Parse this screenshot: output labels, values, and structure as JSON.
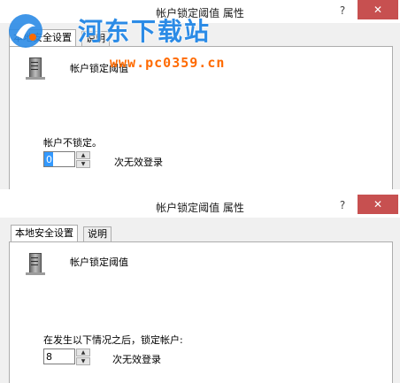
{
  "top_dialog": {
    "title": "帐户锁定阈值 属性",
    "help": "?",
    "close": "✕",
    "tabs": [
      {
        "label": "本地安全设置"
      },
      {
        "label": "说明"
      }
    ],
    "policy_name": "帐户锁定阈值",
    "lockout_label": "帐户不锁定。",
    "spinner_value": "0",
    "spinner_suffix": "次无效登录"
  },
  "bottom_dialog": {
    "title": "帐户锁定阈值 属性",
    "help": "?",
    "close": "✕",
    "tabs": [
      {
        "label": "本地安全设置"
      },
      {
        "label": "说明"
      }
    ],
    "policy_name": "帐户锁定阈值",
    "lockout_label": "在发生以下情况之后，锁定帐户:",
    "spinner_value": "8",
    "spinner_suffix": "次无效登录"
  },
  "watermark": {
    "site_name": "河东下载站",
    "url": "www.pc0359.cn"
  },
  "colors": {
    "close_button": "#c75050",
    "selection": "#3399ff",
    "watermark_blue": "#2b8be6",
    "watermark_orange": "#ff6a00"
  }
}
